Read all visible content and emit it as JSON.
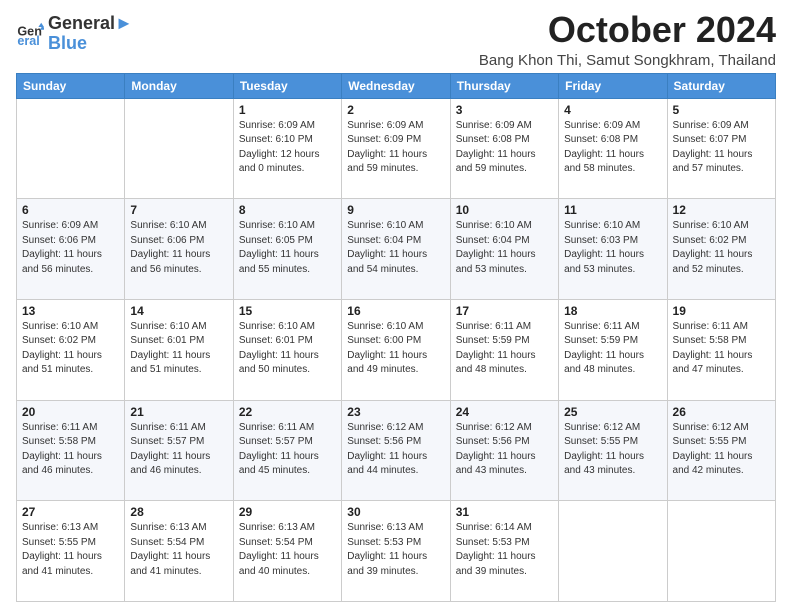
{
  "logo": {
    "line1": "General",
    "line2": "Blue"
  },
  "title": "October 2024",
  "subtitle": "Bang Khon Thi, Samut Songkhram, Thailand",
  "days_header": [
    "Sunday",
    "Monday",
    "Tuesday",
    "Wednesday",
    "Thursday",
    "Friday",
    "Saturday"
  ],
  "weeks": [
    [
      {
        "day": "",
        "info": ""
      },
      {
        "day": "",
        "info": ""
      },
      {
        "day": "1",
        "info": "Sunrise: 6:09 AM\nSunset: 6:10 PM\nDaylight: 12 hours\nand 0 minutes."
      },
      {
        "day": "2",
        "info": "Sunrise: 6:09 AM\nSunset: 6:09 PM\nDaylight: 11 hours\nand 59 minutes."
      },
      {
        "day": "3",
        "info": "Sunrise: 6:09 AM\nSunset: 6:08 PM\nDaylight: 11 hours\nand 59 minutes."
      },
      {
        "day": "4",
        "info": "Sunrise: 6:09 AM\nSunset: 6:08 PM\nDaylight: 11 hours\nand 58 minutes."
      },
      {
        "day": "5",
        "info": "Sunrise: 6:09 AM\nSunset: 6:07 PM\nDaylight: 11 hours\nand 57 minutes."
      }
    ],
    [
      {
        "day": "6",
        "info": "Sunrise: 6:09 AM\nSunset: 6:06 PM\nDaylight: 11 hours\nand 56 minutes."
      },
      {
        "day": "7",
        "info": "Sunrise: 6:10 AM\nSunset: 6:06 PM\nDaylight: 11 hours\nand 56 minutes."
      },
      {
        "day": "8",
        "info": "Sunrise: 6:10 AM\nSunset: 6:05 PM\nDaylight: 11 hours\nand 55 minutes."
      },
      {
        "day": "9",
        "info": "Sunrise: 6:10 AM\nSunset: 6:04 PM\nDaylight: 11 hours\nand 54 minutes."
      },
      {
        "day": "10",
        "info": "Sunrise: 6:10 AM\nSunset: 6:04 PM\nDaylight: 11 hours\nand 53 minutes."
      },
      {
        "day": "11",
        "info": "Sunrise: 6:10 AM\nSunset: 6:03 PM\nDaylight: 11 hours\nand 53 minutes."
      },
      {
        "day": "12",
        "info": "Sunrise: 6:10 AM\nSunset: 6:02 PM\nDaylight: 11 hours\nand 52 minutes."
      }
    ],
    [
      {
        "day": "13",
        "info": "Sunrise: 6:10 AM\nSunset: 6:02 PM\nDaylight: 11 hours\nand 51 minutes."
      },
      {
        "day": "14",
        "info": "Sunrise: 6:10 AM\nSunset: 6:01 PM\nDaylight: 11 hours\nand 51 minutes."
      },
      {
        "day": "15",
        "info": "Sunrise: 6:10 AM\nSunset: 6:01 PM\nDaylight: 11 hours\nand 50 minutes."
      },
      {
        "day": "16",
        "info": "Sunrise: 6:10 AM\nSunset: 6:00 PM\nDaylight: 11 hours\nand 49 minutes."
      },
      {
        "day": "17",
        "info": "Sunrise: 6:11 AM\nSunset: 5:59 PM\nDaylight: 11 hours\nand 48 minutes."
      },
      {
        "day": "18",
        "info": "Sunrise: 6:11 AM\nSunset: 5:59 PM\nDaylight: 11 hours\nand 48 minutes."
      },
      {
        "day": "19",
        "info": "Sunrise: 6:11 AM\nSunset: 5:58 PM\nDaylight: 11 hours\nand 47 minutes."
      }
    ],
    [
      {
        "day": "20",
        "info": "Sunrise: 6:11 AM\nSunset: 5:58 PM\nDaylight: 11 hours\nand 46 minutes."
      },
      {
        "day": "21",
        "info": "Sunrise: 6:11 AM\nSunset: 5:57 PM\nDaylight: 11 hours\nand 46 minutes."
      },
      {
        "day": "22",
        "info": "Sunrise: 6:11 AM\nSunset: 5:57 PM\nDaylight: 11 hours\nand 45 minutes."
      },
      {
        "day": "23",
        "info": "Sunrise: 6:12 AM\nSunset: 5:56 PM\nDaylight: 11 hours\nand 44 minutes."
      },
      {
        "day": "24",
        "info": "Sunrise: 6:12 AM\nSunset: 5:56 PM\nDaylight: 11 hours\nand 43 minutes."
      },
      {
        "day": "25",
        "info": "Sunrise: 6:12 AM\nSunset: 5:55 PM\nDaylight: 11 hours\nand 43 minutes."
      },
      {
        "day": "26",
        "info": "Sunrise: 6:12 AM\nSunset: 5:55 PM\nDaylight: 11 hours\nand 42 minutes."
      }
    ],
    [
      {
        "day": "27",
        "info": "Sunrise: 6:13 AM\nSunset: 5:55 PM\nDaylight: 11 hours\nand 41 minutes."
      },
      {
        "day": "28",
        "info": "Sunrise: 6:13 AM\nSunset: 5:54 PM\nDaylight: 11 hours\nand 41 minutes."
      },
      {
        "day": "29",
        "info": "Sunrise: 6:13 AM\nSunset: 5:54 PM\nDaylight: 11 hours\nand 40 minutes."
      },
      {
        "day": "30",
        "info": "Sunrise: 6:13 AM\nSunset: 5:53 PM\nDaylight: 11 hours\nand 39 minutes."
      },
      {
        "day": "31",
        "info": "Sunrise: 6:14 AM\nSunset: 5:53 PM\nDaylight: 11 hours\nand 39 minutes."
      },
      {
        "day": "",
        "info": ""
      },
      {
        "day": "",
        "info": ""
      }
    ]
  ]
}
